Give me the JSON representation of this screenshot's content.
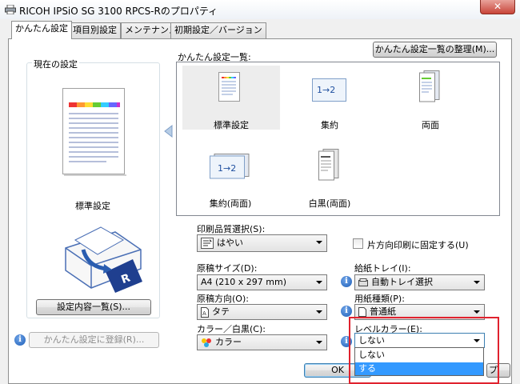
{
  "window": {
    "title": "RICOH IPSiO SG 3100 RPCS-Rのプロパティ",
    "close_glyph": "✕"
  },
  "tabs": [
    {
      "label": "かんたん設定"
    },
    {
      "label": "項目別設定"
    },
    {
      "label": "メンテナンス"
    },
    {
      "label": "初期設定／バージョン"
    }
  ],
  "left": {
    "group_label": "現在の設定",
    "preview_caption": "標準設定",
    "list_button": "設定内容一覧(S)...",
    "register_button": "かんたん設定に登録(R)..."
  },
  "easy_settings": {
    "label": "かんたん設定一覧:",
    "organize_button": "かんたん設定一覧の整理(M)...",
    "items": [
      {
        "label": "標準設定",
        "selected": true
      },
      {
        "label": "集約",
        "icon_text": "1→2"
      },
      {
        "label": "両面"
      },
      {
        "label": "集約(両面)",
        "icon_text": "1→2"
      },
      {
        "label": "白黒(両面)"
      }
    ]
  },
  "form": {
    "quality": {
      "label": "印刷品質選択(S):",
      "value": "はやい"
    },
    "one_side": {
      "label": "片方向印刷に固定する(U)",
      "checked": false
    },
    "paper_size": {
      "label": "原稿サイズ(D):",
      "value": "A4 (210 x 297 mm)"
    },
    "tray": {
      "label": "給紙トレイ(I):",
      "value": "自動トレイ選択"
    },
    "orientation": {
      "label": "原稿方向(O):",
      "value": "タテ"
    },
    "paper_type": {
      "label": "用紙種類(P):",
      "value": "普通紙"
    },
    "color": {
      "label": "カラー／白黒(C):",
      "value": "カラー"
    },
    "level_color": {
      "label": "レベルカラー(E):",
      "value": "しない",
      "options": [
        "しない",
        "する"
      ],
      "highlighted": "する"
    }
  },
  "footer": {
    "ok": "OK",
    "partial_label": "プ"
  },
  "colors": {
    "highlight": "#3399ff",
    "annotation_red": "#e0222e",
    "info_blue": "#1f5fb8"
  }
}
